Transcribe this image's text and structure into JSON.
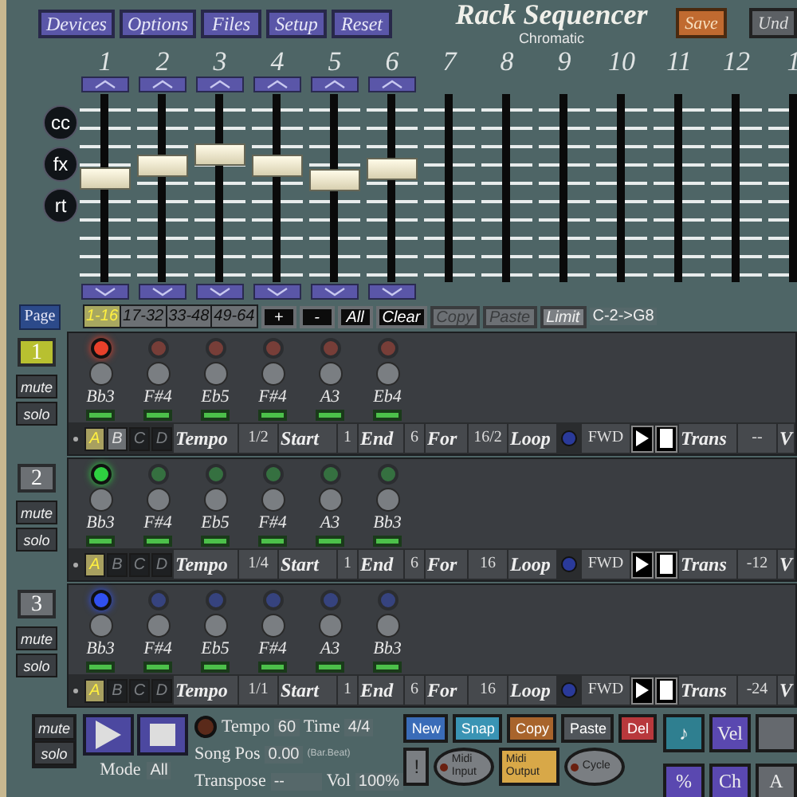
{
  "menu": [
    "Devices",
    "Options",
    "Files",
    "Setup",
    "Reset"
  ],
  "title": "Rack Sequencer",
  "subtitle": "Chromatic",
  "save_button": "Save",
  "undo_button": "Und",
  "side_buttons": [
    "cc",
    "fx",
    "rt"
  ],
  "faders": [
    {
      "label": "1",
      "kind": "slider",
      "level": 0.56
    },
    {
      "label": "2",
      "kind": "slider",
      "level": 0.63
    },
    {
      "label": "3",
      "kind": "slider",
      "level": 0.69
    },
    {
      "label": "4",
      "kind": "slider",
      "level": 0.63
    },
    {
      "label": "5",
      "kind": "slider",
      "level": 0.55
    },
    {
      "label": "6",
      "kind": "slider",
      "level": 0.61
    },
    {
      "label": "7",
      "kind": "empty"
    },
    {
      "label": "8",
      "kind": "empty"
    },
    {
      "label": "9",
      "kind": "empty"
    },
    {
      "label": "10",
      "kind": "empty"
    },
    {
      "label": "11",
      "kind": "empty"
    },
    {
      "label": "12",
      "kind": "empty"
    },
    {
      "label": "1",
      "kind": "empty"
    }
  ],
  "page_button": "Page",
  "pages": [
    {
      "label": "1-16",
      "selected": true
    },
    {
      "label": "17-32",
      "selected": false
    },
    {
      "label": "33-48",
      "selected": false
    },
    {
      "label": "49-64",
      "selected": false
    }
  ],
  "page_tools": [
    {
      "label": "+",
      "kind": "plain",
      "disabled": false
    },
    {
      "label": "-",
      "kind": "plain",
      "disabled": false
    },
    {
      "label": "All",
      "kind": "plain",
      "disabled": false
    },
    {
      "label": "Clear",
      "kind": "plain",
      "disabled": false
    },
    {
      "label": "Copy",
      "kind": "plain",
      "disabled": true
    },
    {
      "label": "Paste",
      "kind": "plain",
      "disabled": true
    },
    {
      "label": "Limit",
      "kind": "toggle",
      "disabled": false
    }
  ],
  "range_label": "C-2->G8",
  "tracks": [
    {
      "number": "1",
      "selected": true,
      "color": "#e8402a",
      "mute": "mute",
      "solo": "solo",
      "steps": [
        {
          "note": "Bb3",
          "on": true
        },
        {
          "note": "F#4",
          "on": false
        },
        {
          "note": "Eb5",
          "on": false
        },
        {
          "note": "F#4",
          "on": false
        },
        {
          "note": "A3",
          "on": false
        },
        {
          "note": "Eb4",
          "on": false
        }
      ],
      "patterns": [
        {
          "label": "A",
          "selected": true,
          "used": true
        },
        {
          "label": "B",
          "selected": false,
          "used": true
        },
        {
          "label": "C",
          "selected": false,
          "used": false
        },
        {
          "label": "D",
          "selected": false,
          "used": false
        }
      ],
      "tempo_label": "Tempo",
      "tempo": "1/2",
      "start_label": "Start",
      "start": "1",
      "end_label": "End",
      "end": "6",
      "for_label": "For",
      "for": "16/2",
      "loop_label": "Loop",
      "direction": "FWD",
      "trans_label": "Trans",
      "trans": "--",
      "vol_label": "V"
    },
    {
      "number": "2",
      "selected": false,
      "color": "#2ed040",
      "mute": "mute",
      "solo": "solo",
      "steps": [
        {
          "note": "Bb3",
          "on": true
        },
        {
          "note": "F#4",
          "on": false
        },
        {
          "note": "Eb5",
          "on": false
        },
        {
          "note": "F#4",
          "on": false
        },
        {
          "note": "A3",
          "on": false
        },
        {
          "note": "Bb3",
          "on": false
        }
      ],
      "patterns": [
        {
          "label": "A",
          "selected": true,
          "used": true
        },
        {
          "label": "B",
          "selected": false,
          "used": false
        },
        {
          "label": "C",
          "selected": false,
          "used": false
        },
        {
          "label": "D",
          "selected": false,
          "used": false
        }
      ],
      "tempo_label": "Tempo",
      "tempo": "1/4",
      "start_label": "Start",
      "start": "1",
      "end_label": "End",
      "end": "6",
      "for_label": "For",
      "for": "16",
      "loop_label": "Loop",
      "direction": "FWD",
      "trans_label": "Trans",
      "trans": "-12",
      "vol_label": "V"
    },
    {
      "number": "3",
      "selected": false,
      "color": "#3050f0",
      "mute": "mute",
      "solo": "solo",
      "steps": [
        {
          "note": "Bb3",
          "on": true
        },
        {
          "note": "F#4",
          "on": false
        },
        {
          "note": "Eb5",
          "on": false
        },
        {
          "note": "F#4",
          "on": false
        },
        {
          "note": "A3",
          "on": false
        },
        {
          "note": "Bb3",
          "on": false
        }
      ],
      "patterns": [
        {
          "label": "A",
          "selected": true,
          "used": true
        },
        {
          "label": "B",
          "selected": false,
          "used": false
        },
        {
          "label": "C",
          "selected": false,
          "used": false
        },
        {
          "label": "D",
          "selected": false,
          "used": false
        }
      ],
      "tempo_label": "Tempo",
      "tempo": "1/1",
      "start_label": "Start",
      "start": "1",
      "end_label": "End",
      "end": "6",
      "for_label": "For",
      "for": "16",
      "loop_label": "Loop",
      "direction": "FWD",
      "trans_label": "Trans",
      "trans": "-24",
      "vol_label": "V"
    }
  ],
  "transport": {
    "mute": "mute",
    "solo": "solo",
    "mode_label": "Mode",
    "mode": "All",
    "tempo_label": "Tempo",
    "tempo": "60",
    "time_label": "Time",
    "time": "4/4",
    "time_hint": "(Bar.Beat)",
    "songpos_label": "Song Pos",
    "songpos": "0.00",
    "transpose_label": "Transpose",
    "transpose": "--",
    "vol_label": "Vol",
    "vol": "100%"
  },
  "edit_buttons": [
    {
      "label": "New",
      "color": "#3a6cb8"
    },
    {
      "label": "Snap",
      "color": "#3a94b4"
    },
    {
      "label": "Copy",
      "color": "#a8642c"
    },
    {
      "label": "Paste",
      "color": "#50555a"
    },
    {
      "label": "Del",
      "color": "#b8383c"
    }
  ],
  "midi_buttons": [
    {
      "label": "!",
      "kind": "plain",
      "selected": false
    },
    {
      "label": "Midi Input",
      "kind": "led",
      "selected": false
    },
    {
      "label": "Midi Output",
      "kind": "plain",
      "selected": true
    },
    {
      "label": "Cycle",
      "kind": "led",
      "selected": false
    }
  ],
  "mode_buttons": [
    {
      "label": "♪",
      "color": "#2f7f90"
    },
    {
      "label": "Vel",
      "color": "#5a48b0"
    },
    {
      "color": "#65696e"
    },
    {
      "label": "%",
      "color": "#5a48b0"
    },
    {
      "label": "Ch",
      "color": "#5a48b0"
    },
    {
      "label": "A",
      "color": "#65696e"
    }
  ]
}
